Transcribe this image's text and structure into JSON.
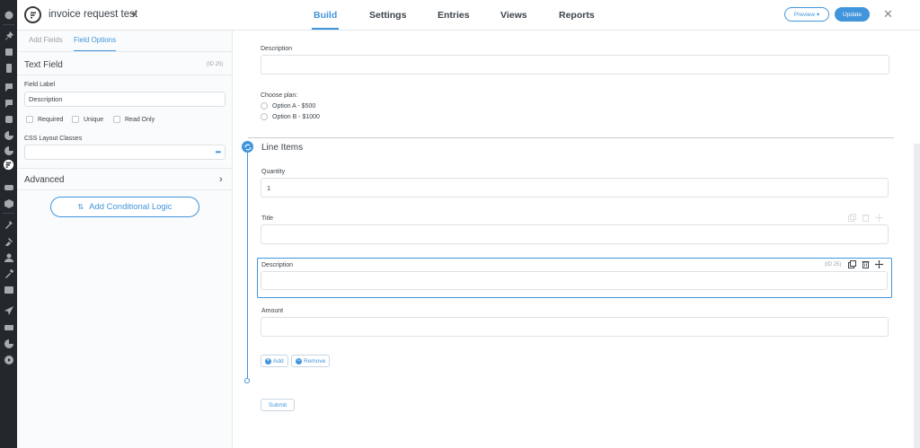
{
  "header": {
    "form_title": "invoice request test",
    "nav": [
      {
        "label": "Build",
        "active": true
      },
      {
        "label": "Settings",
        "active": false
      },
      {
        "label": "Entries",
        "active": false
      },
      {
        "label": "Views",
        "active": false
      },
      {
        "label": "Reports",
        "active": false
      }
    ],
    "preview_label": "Preview ▾",
    "update_label": "Update",
    "close_label": "✕"
  },
  "wp_menu_icons": [
    "dashboard-icon",
    "pin-icon",
    "media-icon",
    "pages-icon",
    "comments-icon",
    "feedback-icon",
    "forms-icon",
    "appearance-icon",
    "formidable-icon",
    "woo-icon",
    "products-icon",
    "tools-icon",
    "plugins-icon",
    "users-icon",
    "wrench-icon",
    "settings-icon",
    "rocket-icon",
    "mail-icon",
    "chart-icon",
    "play-icon"
  ],
  "left_panel": {
    "tabs": [
      {
        "label": "Add Fields",
        "active": false
      },
      {
        "label": "Field Options",
        "active": true
      }
    ],
    "field_type": "Text Field",
    "field_id": "(ID 25)",
    "field_label_caption": "Field Label",
    "field_label_value": "Description",
    "checkboxes": [
      {
        "label": "Required",
        "checked": false
      },
      {
        "label": "Unique",
        "checked": false
      },
      {
        "label": "Read Only",
        "checked": false
      }
    ],
    "css_classes_caption": "CSS Layout Classes",
    "css_classes_value": "",
    "css_classes_dots": "•••",
    "advanced_label": "Advanced",
    "advanced_chevron": "›",
    "conditional_logic_label": "Add Conditional Logic",
    "conditional_logic_icon": "⇅"
  },
  "canvas": {
    "description_label": "Description",
    "choose_plan_label": "Choose plan:",
    "plan_options": [
      "Option A - $500",
      "Option B - $1000"
    ],
    "section_title": "Line Items",
    "quantity_label": "Quantity",
    "quantity_value": "1",
    "title_label": "Title",
    "selected_field_label": "Description",
    "selected_field_id": "(ID 25)",
    "amount_label": "Amount",
    "add_label": "Add",
    "remove_label": "Remove",
    "submit_label": "Submit",
    "accent_color": "#4195db"
  }
}
